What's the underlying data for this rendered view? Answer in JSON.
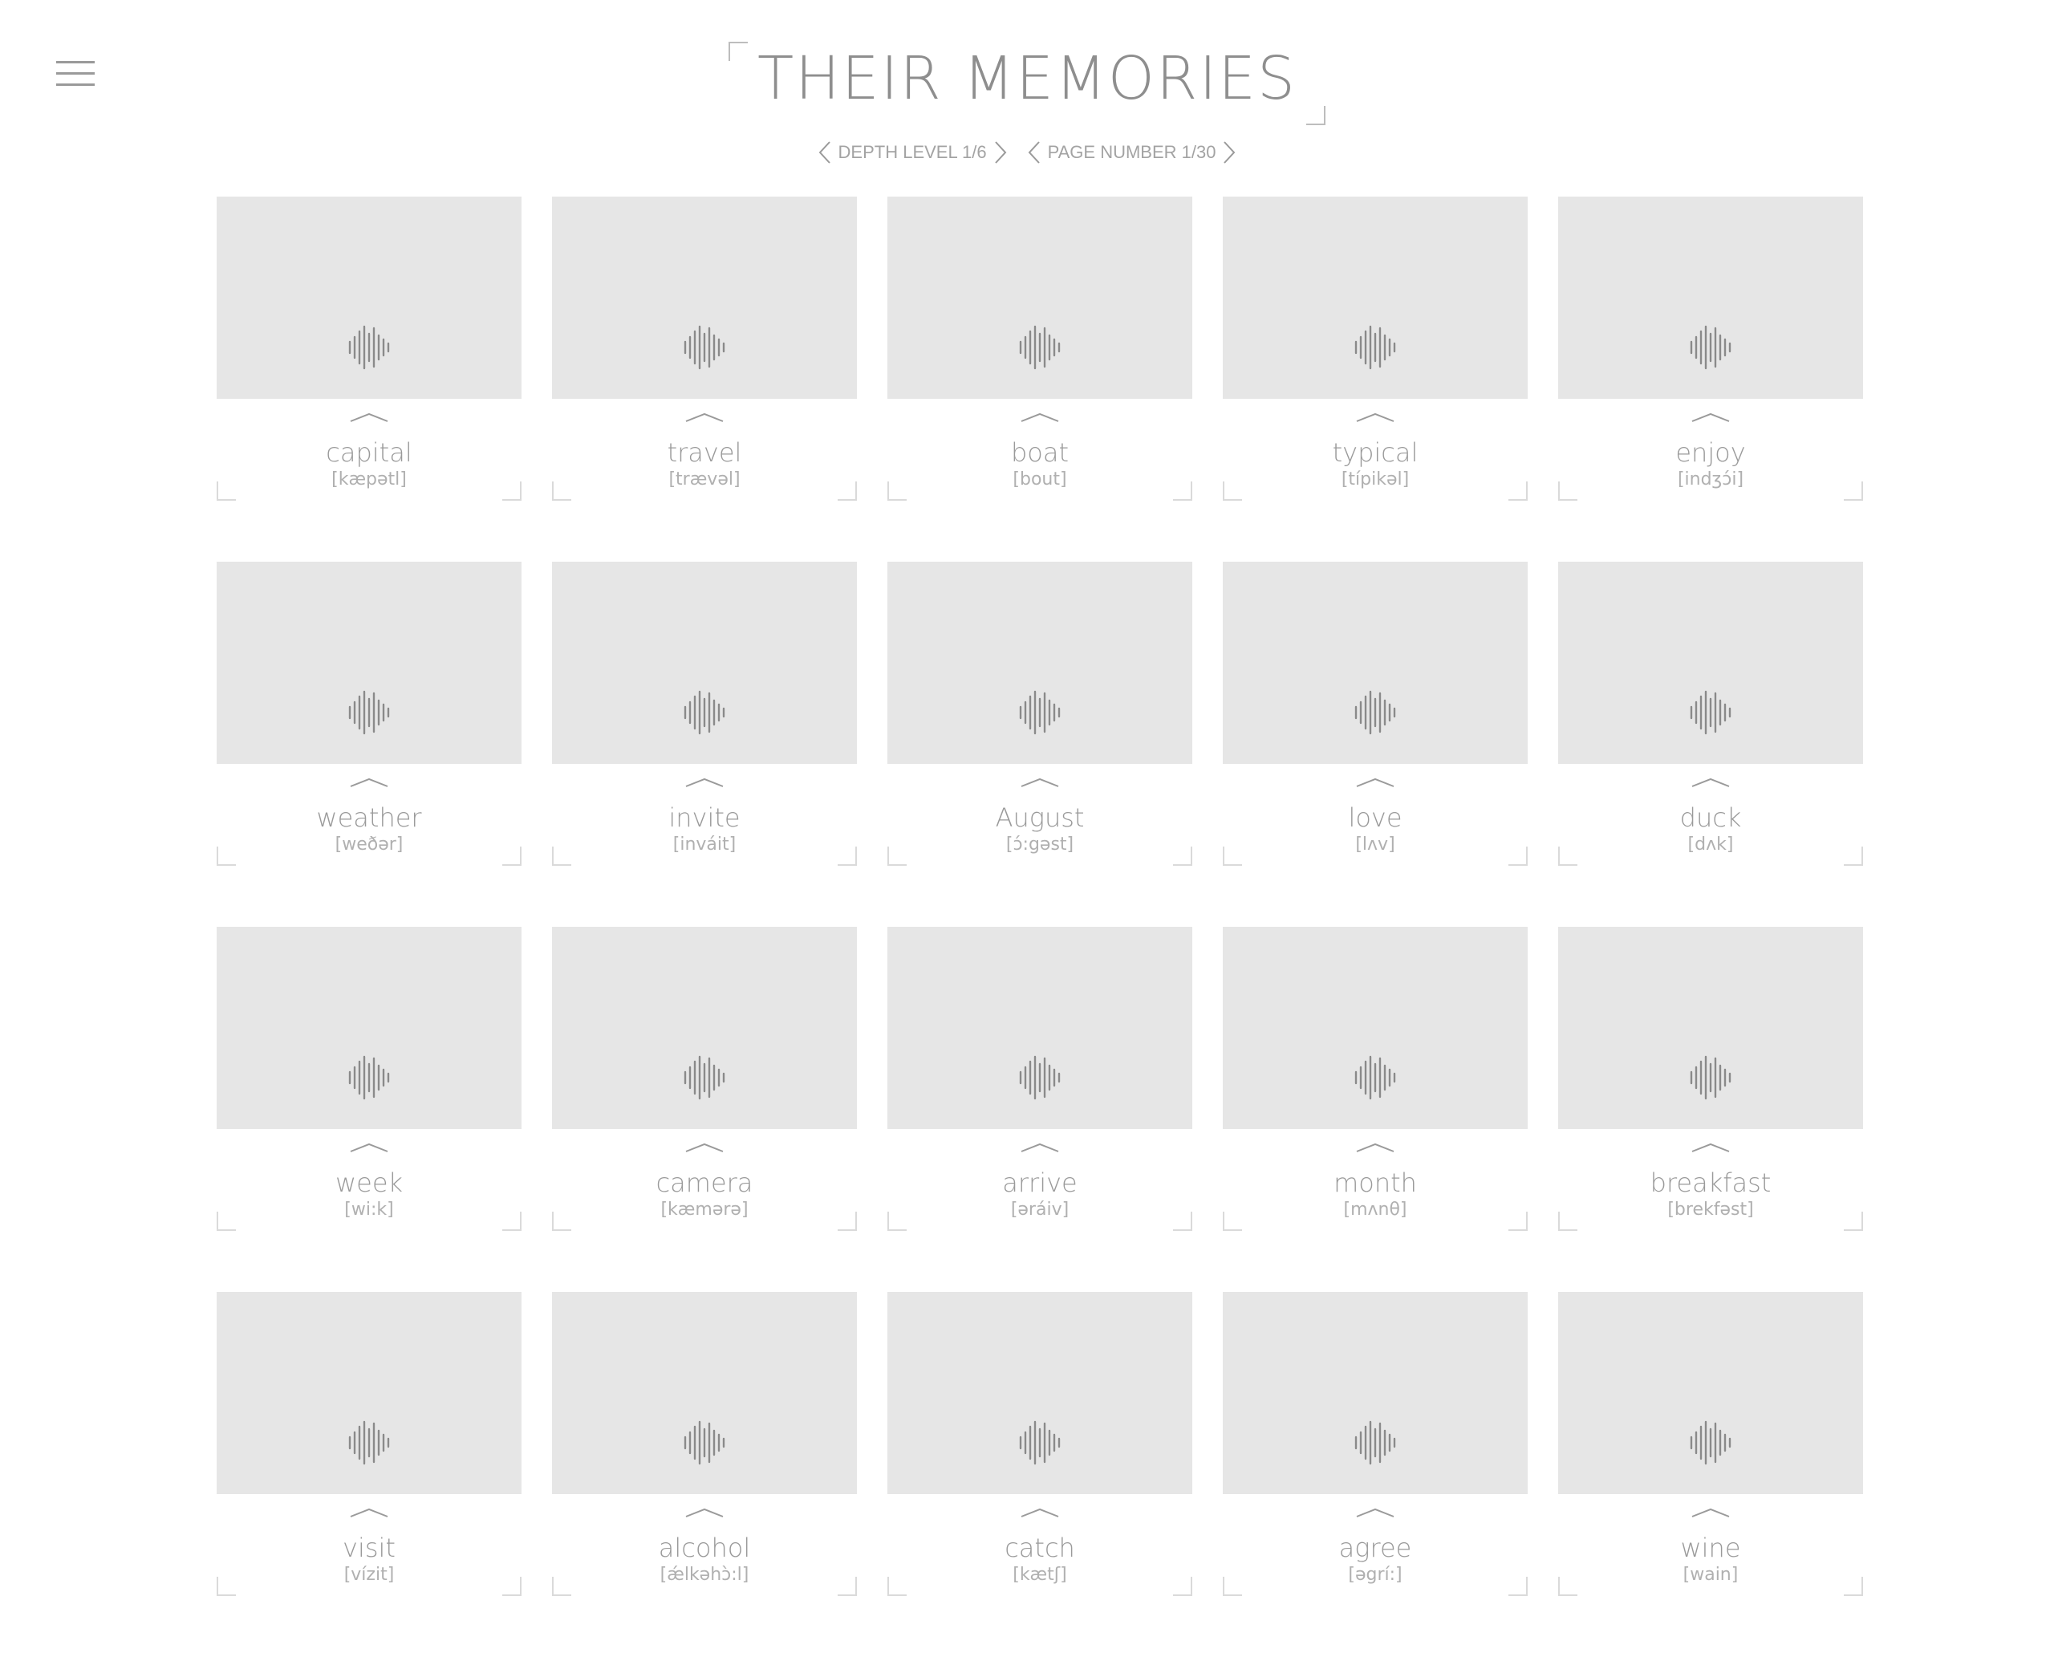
{
  "header": {
    "title": "THEIR MEMORIES"
  },
  "nav": {
    "depth_label": "DEPTH LEVEL 1/6",
    "page_label": "PAGE NUMBER 1/30"
  },
  "cards": [
    {
      "word": "capital",
      "pron": "[kæpətl]"
    },
    {
      "word": "travel",
      "pron": "[trævəl]"
    },
    {
      "word": "boat",
      "pron": "[bout]"
    },
    {
      "word": "typical",
      "pron": "[típikəl]"
    },
    {
      "word": "enjoy",
      "pron": "[indʒɔ́i]"
    },
    {
      "word": "weather",
      "pron": "[weðər]"
    },
    {
      "word": "invite",
      "pron": "[inváit]"
    },
    {
      "word": "August",
      "pron": "[ɔ́:gəst]"
    },
    {
      "word": "love",
      "pron": "[lʌv]"
    },
    {
      "word": "duck",
      "pron": "[dʌk]"
    },
    {
      "word": "week",
      "pron": "[wi:k]"
    },
    {
      "word": "camera",
      "pron": "[kæmərə]"
    },
    {
      "word": "arrive",
      "pron": "[əráiv]"
    },
    {
      "word": "month",
      "pron": "[mʌnθ]"
    },
    {
      "word": "breakfast",
      "pron": "[brekfəst]"
    },
    {
      "word": "visit",
      "pron": "[vízit]"
    },
    {
      "word": "alcohol",
      "pron": "[ǽlkəhɔ̀:l]"
    },
    {
      "word": "catch",
      "pron": "[kætʃ]"
    },
    {
      "word": "agree",
      "pron": "[əgrí:]"
    },
    {
      "word": "wine",
      "pron": "[wain]"
    }
  ]
}
